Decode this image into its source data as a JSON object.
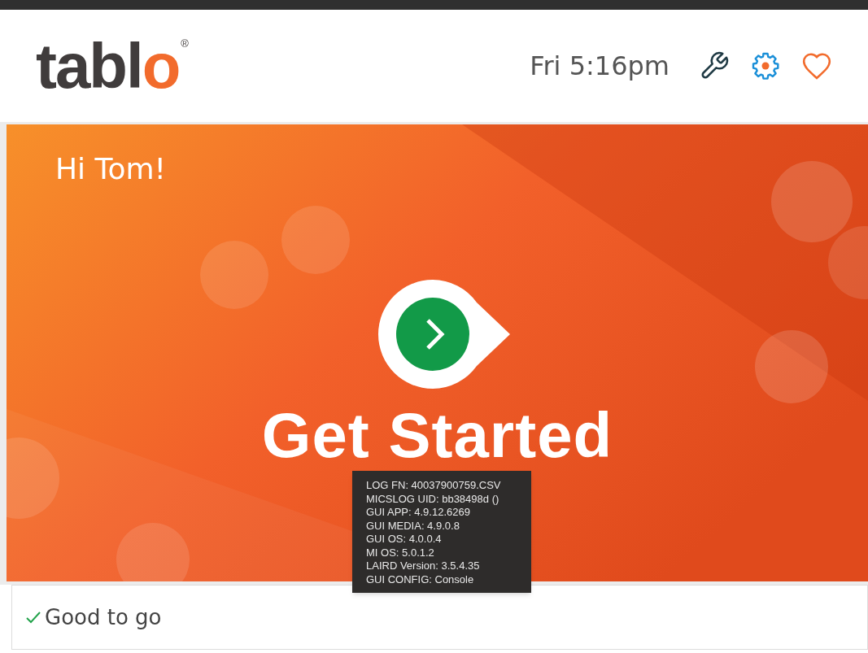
{
  "header": {
    "logo": {
      "text": "tabl",
      "accent": "o",
      "mark": "®"
    },
    "time": "Fri 5:16pm"
  },
  "banner": {
    "greeting": "Hi Tom!",
    "action": "Get Started"
  },
  "debug_tooltip": {
    "lines": [
      "LOG FN: 40037900759.CSV",
      "MICSLOG UID: bb38498d ()",
      "GUI APP: 4.9.12.6269",
      "GUI MEDIA: 4.9.0.8",
      "GUI OS: 4.0.0.4",
      "MI OS: 5.0.1.2",
      "LAIRD Version: 3.5.4.35",
      "GUI CONFIG: Console"
    ]
  },
  "status_bar": {
    "ok": true,
    "text": "Good to go"
  }
}
